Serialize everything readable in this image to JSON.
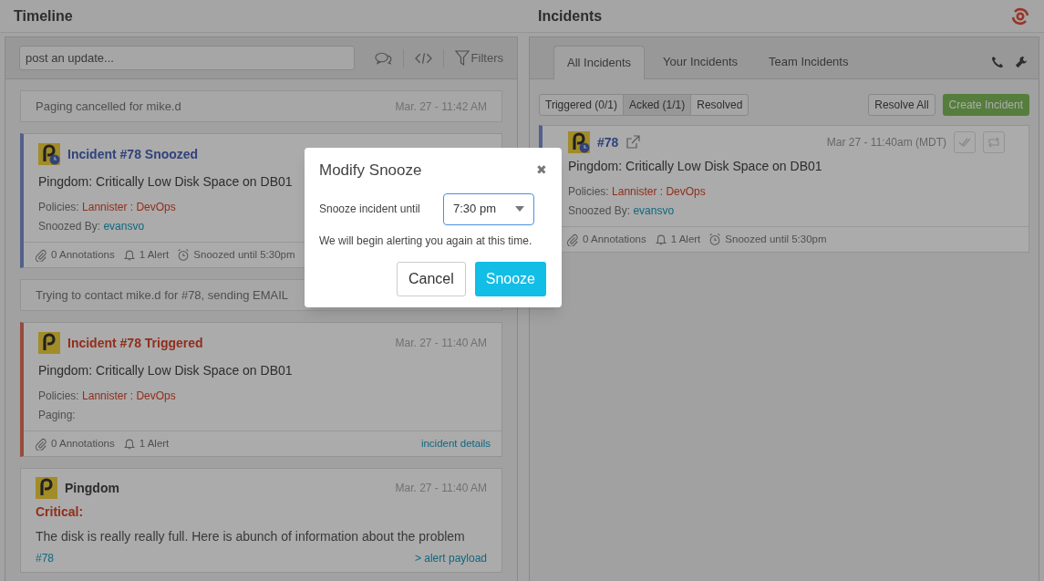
{
  "timeline": {
    "title": "Timeline",
    "post_placeholder": "post an update...",
    "filters": "Filters",
    "entries": [
      {
        "kind": "notice",
        "text": "Paging cancelled for mike.d",
        "time": "Mar. 27 - 11:42 AM"
      },
      {
        "kind": "snoozed_incident",
        "title": "Incident #78 Snoozed",
        "summary": "Pingdom: Critically Low Disk Space on DB01",
        "policies_label": "Policies:",
        "policy": "Lannister : DevOps",
        "detail_label": "Snoozed By:",
        "detail_value": "evansvo",
        "annotations": "0 Annotations",
        "alerts": "1 Alert",
        "snoozed_until": "Snoozed until 5:30pm"
      },
      {
        "kind": "notice",
        "text": "Trying to contact mike.d for #78, sending EMAIL"
      },
      {
        "kind": "triggered_incident",
        "title": "Incident #78 Triggered",
        "time": "Mar. 27 - 11:40 AM",
        "summary": "Pingdom: Critically Low Disk Space on DB01",
        "policies_label": "Policies:",
        "policy": "Lannister : DevOps",
        "detail_label": "Paging:",
        "annotations": "0 Annotations",
        "alerts": "1 Alert",
        "link": "incident details"
      },
      {
        "kind": "alert",
        "source": "Pingdom",
        "time": "Mar. 27 - 11:40 AM",
        "severity": "Critical:",
        "message": "The disk is really really full. Here is abunch of information about the problem",
        "incident_link": "#78",
        "payload_link": "> alert payload"
      }
    ]
  },
  "incidents": {
    "title": "Incidents",
    "tabs": [
      {
        "label": "All Incidents",
        "selected": true
      },
      {
        "label": "Your Incidents",
        "selected": false
      },
      {
        "label": "Team Incidents",
        "selected": false
      }
    ],
    "filters": [
      {
        "label": "Triggered (0/1)",
        "selected": false
      },
      {
        "label": "Acked (1/1)",
        "selected": true
      },
      {
        "label": "Resolved",
        "selected": false
      }
    ],
    "resolve_all": "Resolve All",
    "create": "Create Incident",
    "incident": {
      "number": "#78",
      "time": "Mar 27 - 11:40am (MDT)",
      "summary": "Pingdom: Critically Low Disk Space on DB01",
      "policies_label": "Policies:",
      "policy": "Lannister : DevOps",
      "detail_label": "Snoozed By:",
      "detail_value": "evansvo",
      "annotations": "0 Annotations",
      "alerts": "1 Alert",
      "snoozed_until": "Snoozed until 5:30pm"
    }
  },
  "modal": {
    "title": "Modify Snooze",
    "close": "✖",
    "field_label": "Snooze incident until",
    "value": "7:30 pm",
    "note": "We will begin alerting you again at this time.",
    "buttons": [
      {
        "kind": "secondary",
        "label": "Cancel"
      },
      {
        "kind": "primary",
        "label": "Snooze"
      }
    ]
  }
}
